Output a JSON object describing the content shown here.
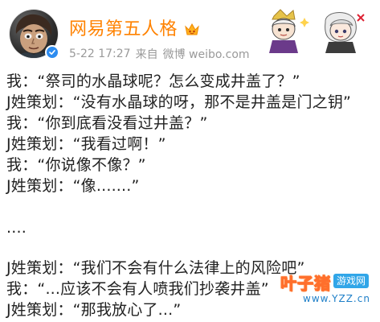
{
  "header": {
    "user_name": "网易第五人格",
    "timestamp": "5-22 17:27",
    "source_prefix": "来自",
    "source": "微博 weibo.com",
    "accent_color": "#ff8200",
    "verified_color": "#2d8cf0",
    "avatar_icon": "character-avatar-icon",
    "member_icon": "vip-member-icon",
    "decor_icon": "anime-characters-sticker-icon"
  },
  "post": {
    "lines": [
      "我：“祭司的水晶球呢？怎么变成井盖了？”",
      "J姓策划：“没有水晶球的呀，那不是井盖是门之钥”",
      "我：“你到底看没看过井盖？”",
      "J姓策划：“我看过啊！”",
      "我：“你说像不像？”",
      "J姓策划：“像.......”",
      "....",
      "J姓策划：“我们不会有什么法律上的风险吧”",
      "我：“...应该不会有人喷我们抄袭井盖”",
      "J姓策划：“那我放心了...”"
    ]
  },
  "watermark": {
    "logo": "叶子猪",
    "tag": "游戏网",
    "url": "www.YZZ.cn"
  }
}
